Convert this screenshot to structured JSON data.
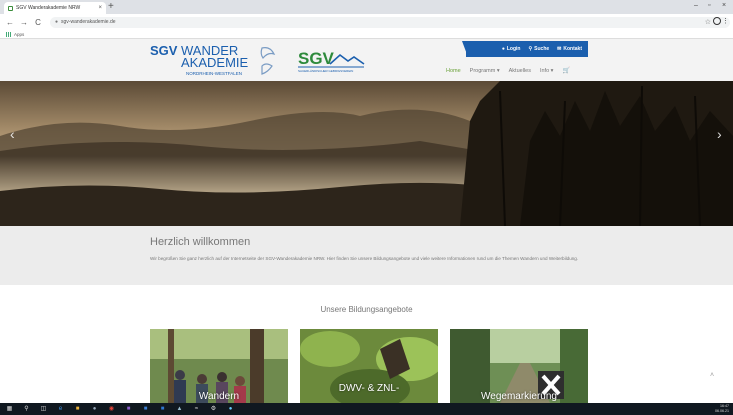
{
  "browser": {
    "tab_title": "SGV Wanderakademie NRW",
    "tab_close": "×",
    "new_tab": "+",
    "url": "sgv-wanderakademie.de",
    "back": "←",
    "forward": "→",
    "reload": "C",
    "bookmark_apps": "Apps",
    "minimize": "–",
    "maximize": "▫",
    "close": "×"
  },
  "site": {
    "logo_wanderakademie": {
      "line1_sgv": "SGV",
      "line1_wander": "WANDER",
      "line2": "AKADEMIE",
      "line3": "NORDRHEIN-WESTFALEN"
    },
    "logo_sgv": {
      "text": "SGV",
      "subtitle": "SAUERLÄNDISCHER GEBIRGSVEREIN"
    },
    "topbar": {
      "login": "Login",
      "search": "Suche",
      "contact": "Kontakt"
    },
    "nav": [
      {
        "label": "Home",
        "active": true
      },
      {
        "label": "Programm ▾",
        "active": false
      },
      {
        "label": "Aktuelles",
        "active": false
      },
      {
        "label": "Info ▾",
        "active": false
      }
    ],
    "colors": {
      "brand_blue": "#1b5fae",
      "nav_active_green": "#6ba23a"
    }
  },
  "hero": {
    "prev_arrow": "‹",
    "next_arrow": "›"
  },
  "welcome": {
    "title": "Herzlich willkommen",
    "text": "Wir begrüßen Sie ganz herzlich auf der Internetseite der SGV-Wanderakademie NRW. Hier finden Sie unsere Bildungsangebote und viele weitere Informationen rund um die Themen Wandern und Weiterbildung."
  },
  "offers": {
    "title": "Unsere Bildungsangebote",
    "cards": [
      {
        "label": "Wandern"
      },
      {
        "label": "DWV- & ZNL-"
      },
      {
        "label": "Wegemarkierung"
      }
    ]
  },
  "scroll_top": "˄",
  "taskbar": {
    "time": "16:47",
    "date": "06.06.21"
  }
}
